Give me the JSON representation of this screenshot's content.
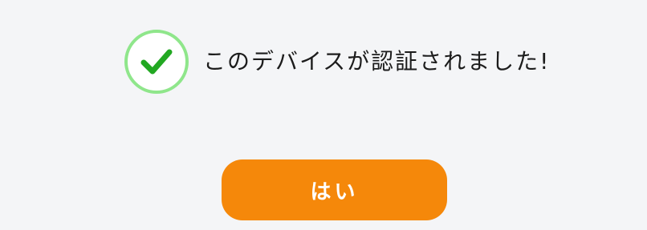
{
  "dialog": {
    "status": {
      "icon": "check-circle-icon",
      "text": "このデバイスが認証されました!"
    },
    "confirm_button": {
      "label": "はい"
    }
  },
  "colors": {
    "background": "#f4f5f7",
    "check_ring": "#8fe68b",
    "check_mark": "#22a822",
    "button": "#f5880a",
    "button_text": "#ffffff"
  }
}
